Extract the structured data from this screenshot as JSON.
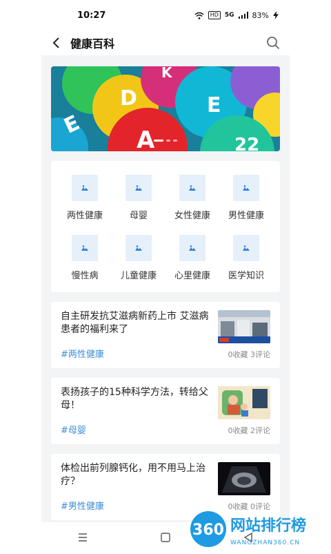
{
  "status_bar": {
    "time": "10:27",
    "hd": "HD",
    "network": "5G",
    "battery": "83%"
  },
  "app_bar": {
    "title": "健康百科",
    "back_icon": "back-arrow-icon",
    "search_icon": "search-icon"
  },
  "banner": {
    "letters": [
      "E",
      "D",
      "A",
      "E",
      "K",
      "22"
    ],
    "dots": 3,
    "active_dot": 1
  },
  "categories": [
    {
      "label": "两性健康"
    },
    {
      "label": "母婴"
    },
    {
      "label": "女性健康"
    },
    {
      "label": "男性健康"
    },
    {
      "label": "慢性病"
    },
    {
      "label": "儿童健康"
    },
    {
      "label": "心里健康"
    },
    {
      "label": "医学知识"
    }
  ],
  "articles": [
    {
      "title": "自主研发抗艾滋病新药上市 艾滋病患者的福利来了",
      "tag": "#两性健康",
      "meta": "0收藏 3评论"
    },
    {
      "title": "表扬孩子的15种科学方法，转给父母！",
      "tag": "#母婴",
      "meta": "0收藏 2评论"
    },
    {
      "title": "体检出前列腺钙化，用不用马上治疗？",
      "tag": "#男性健康",
      "meta": "0收藏 0评论"
    }
  ],
  "watermark": {
    "logo": "360",
    "name": "网站排行榜",
    "url": "WANGZHAN360.CN"
  },
  "colors": {
    "accent": "#3b8ed8",
    "icon_bg": "#e6f0fb",
    "page_bg": "#f3f4f6"
  }
}
